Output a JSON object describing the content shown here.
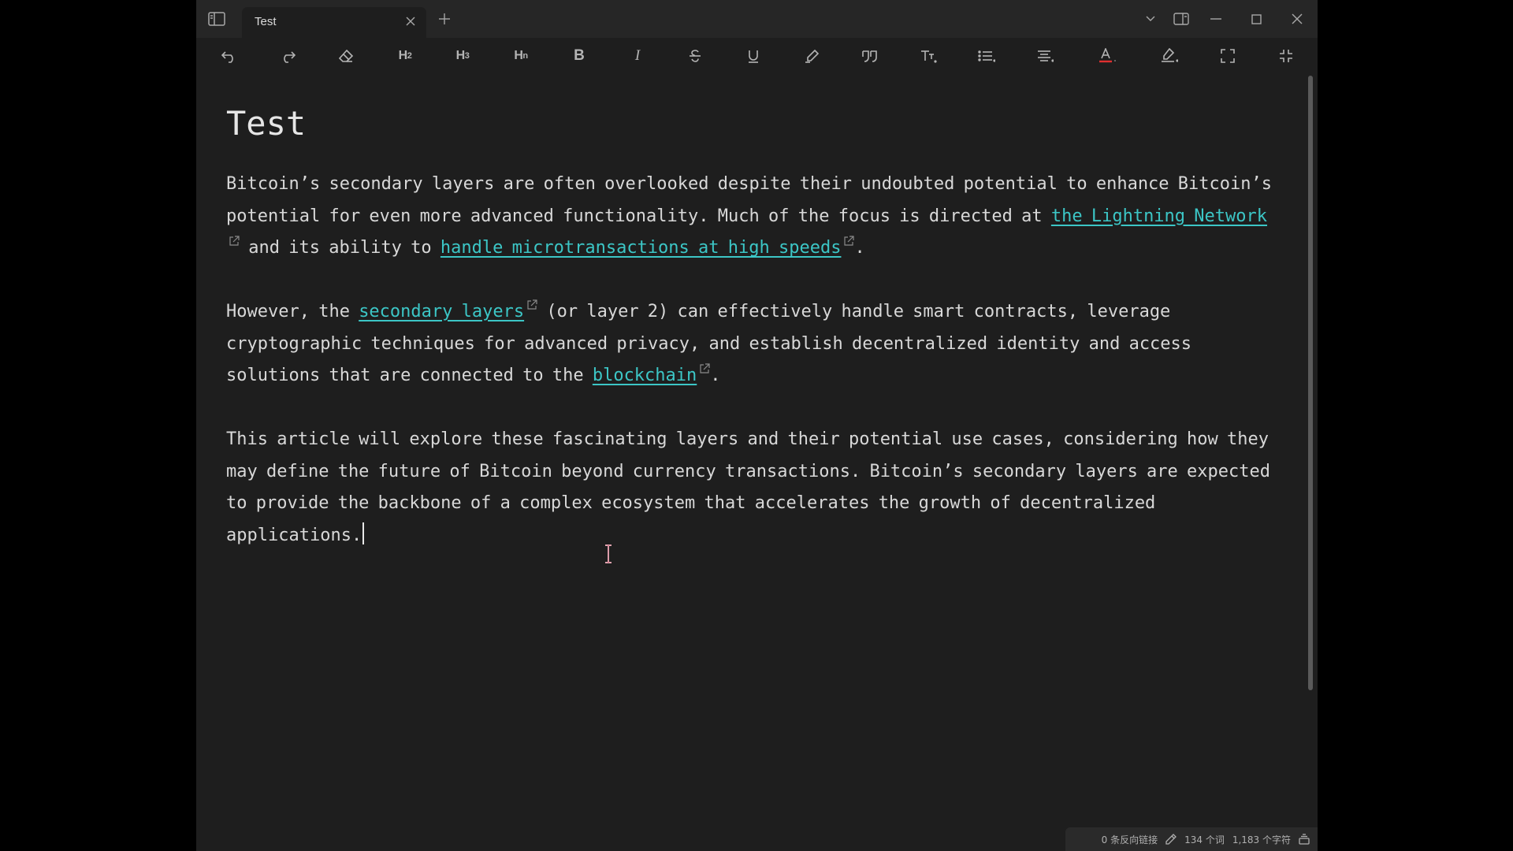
{
  "window": {
    "tab_title": "Test"
  },
  "toolbar": {
    "h2": "H",
    "h2_sub": "2",
    "h3": "H",
    "h3_sub": "3",
    "hn": "H",
    "hn_sub": "n",
    "bold": "B",
    "italic": "I"
  },
  "document": {
    "title": "Test",
    "paragraphs": [
      {
        "before": "Bitcoin’s secondary layers are often overlooked despite their undoubted potential to enhance Bitcoin’s potential for even more advanced functionality. Much of the focus is directed at ",
        "link1": "the Lightning Network",
        "middle": " and its ability to ",
        "link2": "handle microtransactions at high speeds",
        "after": "."
      },
      {
        "before": "However, the ",
        "link1": "secondary layers",
        "middle": " (or layer 2) can effectively handle smart contracts, leverage cryptographic techniques for advanced privacy, and establish decentralized identity and access solutions that are connected to the ",
        "link2": "blockchain",
        "after": "."
      },
      {
        "text": "This article will explore these fascinating layers and their potential use cases, considering how they may define the future of Bitcoin beyond currency transactions. Bitcoin’s secondary layers are expected to provide the backbone of a complex ecosystem that accelerates the growth of decentralized applications."
      }
    ]
  },
  "statusbar": {
    "backlinks": "0 条反向链接",
    "words": "134 个词",
    "chars": "1,183 个字符"
  },
  "colors": {
    "link": "#3cc6c6",
    "text_color_indicator": "#e03030"
  },
  "icons": {
    "sidebar_toggle": "sidebar-toggle-icon",
    "tab_close": "close-icon",
    "new_tab": "plus-icon",
    "tab_list": "chevron-down-icon",
    "split_view": "split-view-icon",
    "minimize": "minimize-icon",
    "maximize": "maximize-icon",
    "close": "close-icon",
    "undo": "undo-icon",
    "redo": "redo-icon",
    "clear_format": "eraser-icon",
    "strikethrough": "strikethrough-icon",
    "underline": "underline-icon",
    "highlight_pen": "marker-icon",
    "quote": "quote-icon",
    "text_size": "text-size-icon",
    "list": "list-icon",
    "align": "align-icon",
    "text_color": "text-color-icon",
    "highlight_color": "highlight-icon",
    "fullscreen": "fullscreen-icon",
    "exit_fullscreen": "exit-fullscreen-icon",
    "edit_mode": "pencil-icon",
    "status_extra": "stack-icon"
  }
}
